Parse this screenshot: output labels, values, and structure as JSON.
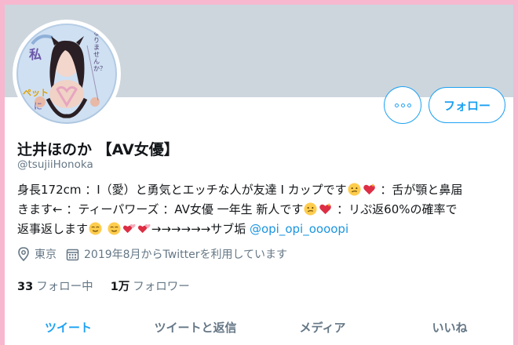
{
  "profile": {
    "name": "辻井ほのか 【AV女優】",
    "handle": "@tsujiiHonoka",
    "avatar_text": {
      "t1": "私",
      "t2": "ペット",
      "t3": "に",
      "t4": "なりませんか？"
    },
    "bio": {
      "line1": "身長172cm ：I（愛）と勇気とエッチな人が友達 I カップです",
      "line1b": " ：舌が顎と鼻届",
      "line2": "きます← ：ティーパワーズ ：AV女優 一年生 新人です",
      "line2b": " ：リぷ返60%の確率で",
      "line3": "返事返します",
      "line3b": "→→→→→→サブ垢 ",
      "mention": "@opi_opi_oooopi"
    },
    "location": "東京",
    "joined": "2019年8月からTwitterを利用しています",
    "following_count": "33",
    "following_label": "フォロー中",
    "followers_count": "1万",
    "followers_label": "フォロワー"
  },
  "actions": {
    "follow_label": "フォロー"
  },
  "tabs": [
    {
      "label": "ツイート",
      "active": true
    },
    {
      "label": "ツイートと返信",
      "active": false
    },
    {
      "label": "メディア",
      "active": false
    },
    {
      "label": "いいね",
      "active": false
    }
  ],
  "colors": {
    "accent": "#1da1f2",
    "frame": "#f7b8cf",
    "banner": "#cdd6dd",
    "muted": "#657786"
  },
  "icons": {
    "more": "more-dots-icon",
    "location": "location-pin-icon",
    "calendar": "calendar-icon",
    "emoji_confused": "confused-face-emoji",
    "emoji_heart": "sparkling-heart-emoji",
    "emoji_relieved": "relieved-face-emoji",
    "emoji_two_hearts": "two-hearts-emoji"
  }
}
